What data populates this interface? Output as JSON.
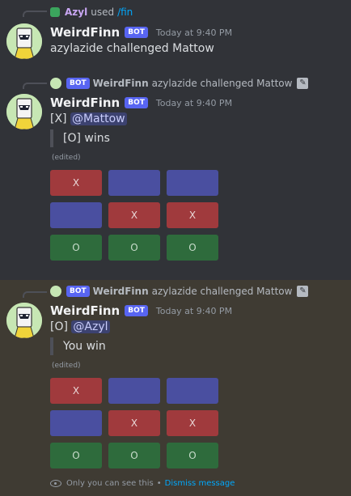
{
  "messages": [
    {
      "reply": {
        "user": "Azyl",
        "used": "used",
        "command": "/fin"
      },
      "author": "WeirdFinn",
      "bot_tag": "BOT",
      "timestamp": "Today at 9:40 PM",
      "text": "azylazide challenged Mattow"
    },
    {
      "reply": {
        "bot_tag": "BOT",
        "author": "WeirdFinn",
        "text": "azylazide challenged Mattow"
      },
      "author": "WeirdFinn",
      "bot_tag": "BOT",
      "timestamp": "Today at 9:40 PM",
      "line1_prefix": "[X]",
      "line1_mention": "@Mattow",
      "quote": "[O] wins",
      "edited": "(edited)",
      "board": [
        [
          "X",
          "",
          ""
        ],
        [
          "",
          "X",
          "X"
        ],
        [
          "O",
          "O",
          "O"
        ]
      ],
      "board_colors": [
        [
          "red",
          "blue",
          "blue"
        ],
        [
          "blue",
          "red",
          "red"
        ],
        [
          "green",
          "green",
          "green"
        ]
      ]
    },
    {
      "reply": {
        "bot_tag": "BOT",
        "author": "WeirdFinn",
        "text": "azylazide challenged Mattow"
      },
      "author": "WeirdFinn",
      "bot_tag": "BOT",
      "timestamp": "Today at 9:40 PM",
      "line1_prefix": "[O]",
      "line1_mention": "@Azyl",
      "quote": "You win",
      "edited": "(edited)",
      "board": [
        [
          "X",
          "",
          ""
        ],
        [
          "",
          "X",
          "X"
        ],
        [
          "O",
          "O",
          "O"
        ]
      ],
      "board_colors": [
        [
          "red",
          "blue",
          "blue"
        ],
        [
          "blue",
          "red",
          "red"
        ],
        [
          "green",
          "green",
          "green"
        ]
      ],
      "ephemeral": {
        "notice": "Only you can see this",
        "separator": "•",
        "dismiss": "Dismiss message"
      }
    }
  ],
  "colors": {
    "background": "#313338",
    "ephemeral_bg": "#3f3b33",
    "blurple": "#5865f2",
    "link": "#00a8fc"
  }
}
